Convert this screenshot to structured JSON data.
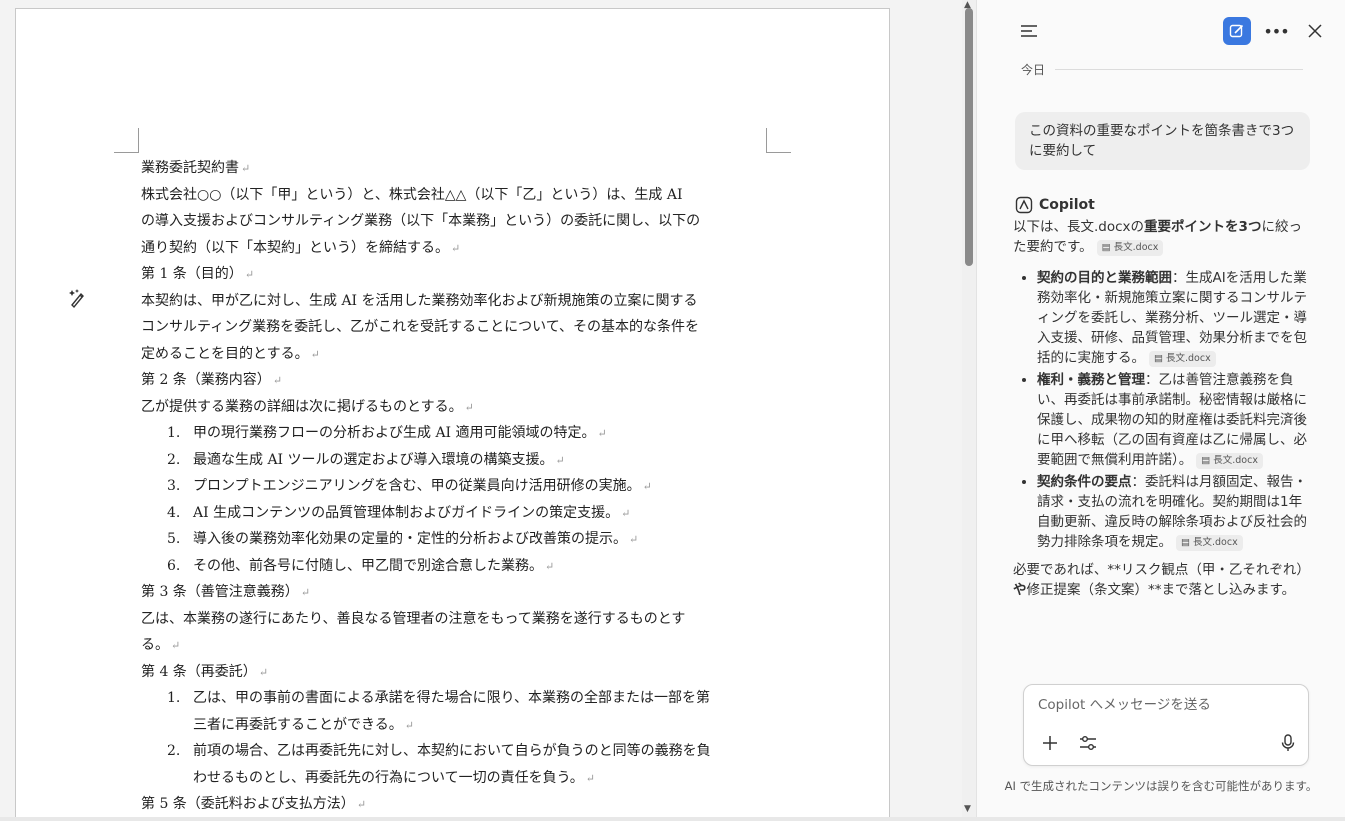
{
  "document": {
    "lines": [
      {
        "text": "業務委託契約書"
      },
      {
        "text": "株式会社○○（以下「甲」という）と、株式会社△△（以下「乙」という）は、生成 AI",
        "nomark": true
      },
      {
        "text": "の導入支援およびコンサルティング業務（以下「本業務」という）の委託に関し、以下の",
        "nomark": true
      },
      {
        "text": "通り契約（以下「本契約」という）を締結する。"
      },
      {
        "text": "第 1 条（目的）"
      },
      {
        "text": "本契約は、甲が乙に対し、生成 AI を活用した業務効率化および新規施策の立案に関する",
        "nomark": true
      },
      {
        "text": "コンサルティング業務を委託し、乙がこれを受託することについて、その基本的な条件を",
        "nomark": true
      },
      {
        "text": "定めることを目的とする。"
      },
      {
        "text": "第 2 条（業務内容）"
      },
      {
        "text": "乙が提供する業務の詳細は次に掲げるものとする。"
      },
      {
        "num": "1.",
        "text": "甲の現行業務フローの分析および生成 AI 適用可能領域の特定。"
      },
      {
        "num": "2.",
        "text": "最適な生成 AI ツールの選定および導入環境の構築支援。"
      },
      {
        "num": "3.",
        "text": "プロンプトエンジニアリングを含む、甲の従業員向け活用研修の実施。"
      },
      {
        "num": "4.",
        "text": "AI 生成コンテンツの品質管理体制およびガイドラインの策定支援。"
      },
      {
        "num": "5.",
        "text": "導入後の業務効率化効果の定量的・定性的分析および改善策の提示。"
      },
      {
        "num": "6.",
        "text": "その他、前各号に付随し、甲乙間で別途合意した業務。"
      },
      {
        "text": "第 3 条（善管注意義務）"
      },
      {
        "text": "乙は、本業務の遂行にあたり、善良なる管理者の注意をもって業務を遂行するものとす",
        "nomark": true
      },
      {
        "text": "る。"
      },
      {
        "text": "第 4 条（再委託）"
      },
      {
        "num": "1.",
        "text": "乙は、甲の事前の書面による承諾を得た場合に限り、本業務の全部または一部を第",
        "nomark": true
      },
      {
        "indent": true,
        "text": "三者に再委託することができる。"
      },
      {
        "num": "2.",
        "text": "前項の場合、乙は再委託先に対し、本契約において自らが負うのと同等の義務を負",
        "nomark": true
      },
      {
        "indent": true,
        "text": "わせるものとし、再委託先の行為について一切の責任を負う。"
      },
      {
        "text": "第 5 条（委託料および支払方法）"
      }
    ],
    "paragraph_mark": "↵"
  },
  "copilot": {
    "today_label": "今日",
    "user_message": "この資料の重要なポイントを箇条書きで3つに要約して",
    "name": "Copilot",
    "intro_pre": "以下は、長文.docxの",
    "intro_bold": "重要ポイントを3つ",
    "intro_post": "に絞った要約です。",
    "citation": "長文.docx",
    "bullets": [
      {
        "title": "契約の目的と業務範囲",
        "body": "：生成AIを活用した業務効率化・新規施策立案に関するコンサルティングを委託し、業務分析、ツール選定・導入支援、研修、品質管理、効果分析までを包括的に実施する。"
      },
      {
        "title": "権利・義務と管理",
        "body": "：乙は善管注意義務を負い、再委託は事前承諾制。秘密情報は厳格に保護し、成果物の知的財産権は委託料完済後に甲へ移転（乙の固有資産は乙に帰属し、必要範囲で無償利用許諾）。"
      },
      {
        "title": "契約条件の要点",
        "body": "：委託料は月額固定、報告・請求・支払の流れを明確化。契約期間は1年自動更新、違反時の解除条項および反社会的勢力排除条項を規定。"
      }
    ],
    "closing_pre": "必要であれば、**リスク観点（甲・乙それぞれ）",
    "closing_bold": "や",
    "closing_post": "修正提案（条文案）**まで落とし込みます。",
    "composer_placeholder": "Copilot へメッセージを送る",
    "disclaimer": "AI で生成されたコンテンツは誤りを含む可能性があります。"
  },
  "colors": {
    "accent": "#3a78e0"
  }
}
